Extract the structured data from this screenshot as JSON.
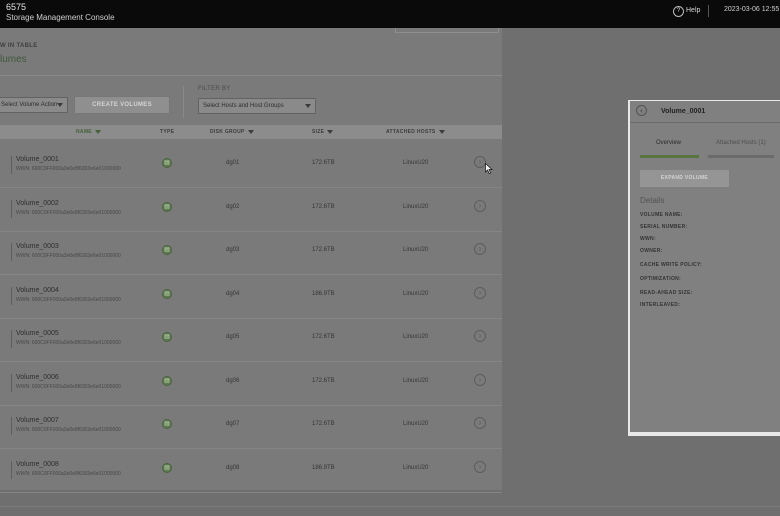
{
  "header": {
    "model": "6575",
    "app_title": "Storage Management Console",
    "help_label": "Help",
    "datetime": "2023-03-06 12:55"
  },
  "page": {
    "breadcrumb": "W IN TABLE",
    "title": "lumes"
  },
  "toolbar": {
    "volume_action": "Select Volume Action",
    "create_label": "CREATE VOLUMES",
    "filter_label": "FILTER BY",
    "filter_select": "Select Hosts and Host Groups"
  },
  "table": {
    "columns": {
      "name": "NAME",
      "type": "TYPE",
      "disk_group": "DISK GROUP",
      "size": "SIZE",
      "attached_hosts": "ATTACHED HOSTS"
    },
    "rows": [
      {
        "name": "Volume_0001",
        "wwn": "WWN: 600C0FF000a3e0e8f6303e6e01000000",
        "disk_group": "dg01",
        "size": "172.6TB",
        "host": "LinuxU20"
      },
      {
        "name": "Volume_0002",
        "wwn": "WWN: 600C0FF000a3e0e8f6303e6e01000000",
        "disk_group": "dg02",
        "size": "172.6TB",
        "host": "LinuxU20"
      },
      {
        "name": "Volume_0003",
        "wwn": "WWN: 600C0FF000a3e0e8f6303e6e01000000",
        "disk_group": "dg03",
        "size": "172.6TB",
        "host": "LinuxU20"
      },
      {
        "name": "Volume_0004",
        "wwn": "WWN: 600C0FF000a3e0e8f6303e6e01000000",
        "disk_group": "dg04",
        "size": "186.9TB",
        "host": "LinuxU20"
      },
      {
        "name": "Volume_0005",
        "wwn": "WWN: 600C0FF000a3e0e8f6303e6e01000000",
        "disk_group": "dg05",
        "size": "172.6TB",
        "host": "LinuxU20"
      },
      {
        "name": "Volume_0006",
        "wwn": "WWN: 600C0FF000a3e0e8f6303e6e01000000",
        "disk_group": "dg06",
        "size": "172.6TB",
        "host": "LinuxU20"
      },
      {
        "name": "Volume_0007",
        "wwn": "WWN: 600C0FF000a3e0e8f6303e6e01000000",
        "disk_group": "dg07",
        "size": "172.6TB",
        "host": "LinuxU20"
      },
      {
        "name": "Volume_0008",
        "wwn": "WWN: 600C0FF000a3e0e8f6303e6e01000000",
        "disk_group": "dg08",
        "size": "186.9TB",
        "host": "LinuxU20"
      }
    ]
  },
  "panel": {
    "title": "Volume_0001",
    "tab_overview": "Overview",
    "tab_hosts": "Attached Hosts (1)",
    "expand_label": "EXPAND VOLUME",
    "details_title": "Details",
    "fields": [
      "VOLUME NAME:",
      "SERIAL NUMBER:",
      "WWN:",
      "OWNER:",
      "CACHE WRITE POLICY:",
      "OPTIMIZATION:",
      "READ-AHEAD SIZE:",
      "INTERLEAVED:"
    ]
  },
  "icons": {
    "type_icon": "volume-type-icon",
    "row_arrow": "chevron-right-icon",
    "back": "chevron-left-icon",
    "help": "help-icon"
  }
}
